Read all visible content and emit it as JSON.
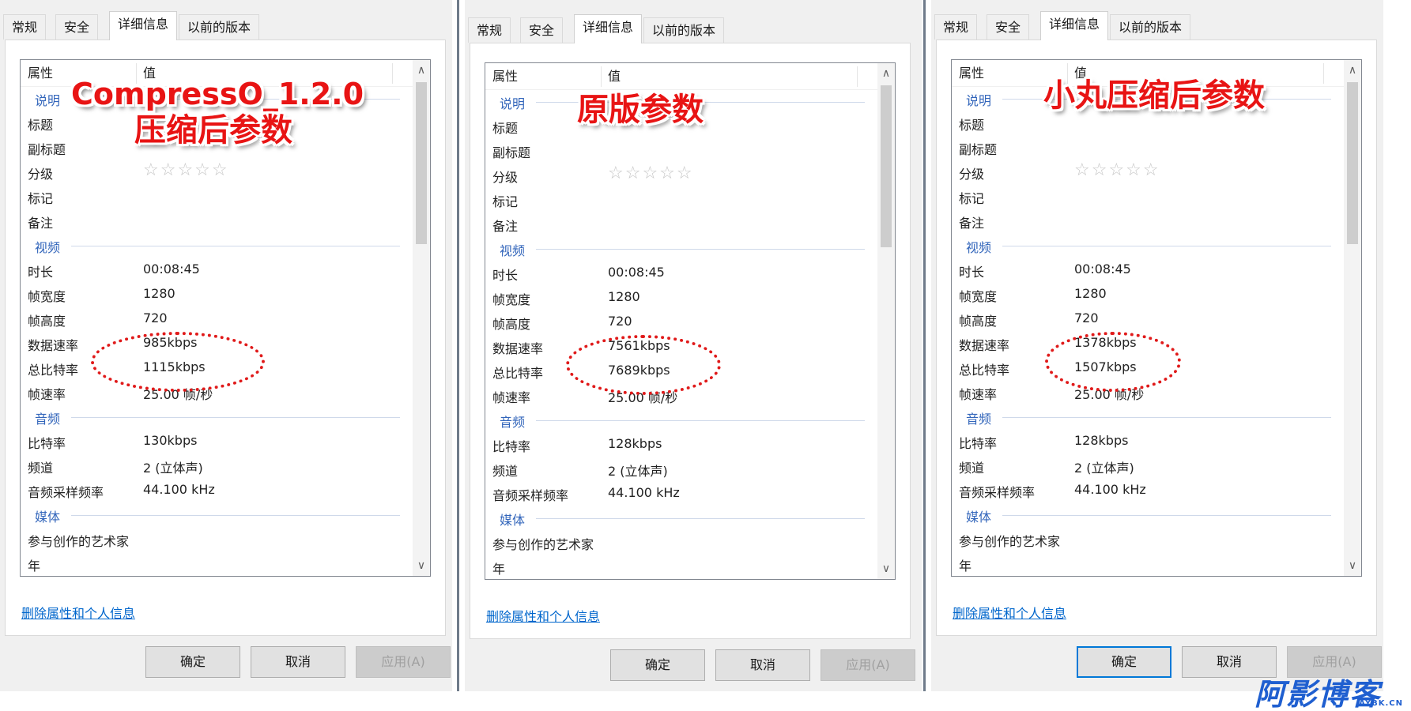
{
  "dialogs": [
    {
      "tabs": [
        "常规",
        "安全",
        "详细信息",
        "以前的版本"
      ],
      "active_tab": "详细信息",
      "columns": {
        "property": "属性",
        "value": "值"
      },
      "annotation_line1": "CompressO_1.2.0",
      "annotation_line2": "压缩后参数",
      "sections": {
        "description": {
          "title": "说明",
          "title_label": "标题",
          "subtitle_label": "副标题",
          "rating_label": "分级",
          "rating_stars": "☆☆☆☆☆",
          "tags_label": "标记",
          "comments_label": "备注"
        },
        "video": {
          "title": "视频",
          "length_label": "时长",
          "length": "00:08:45",
          "width_label": "帧宽度",
          "width": "1280",
          "height_label": "帧高度",
          "height": "720",
          "data_rate_label": "数据速率",
          "data_rate": "985kbps",
          "total_bitrate_label": "总比特率",
          "total_bitrate": "1115kbps",
          "frame_rate_label": "帧速率",
          "frame_rate": "25.00 帧/秒"
        },
        "audio": {
          "title": "音频",
          "bitrate_label": "比特率",
          "bitrate": "130kbps",
          "channels_label": "频道",
          "channels": "2 (立体声)",
          "sample_rate_label": "音频采样频率",
          "sample_rate": "44.100 kHz"
        },
        "media": {
          "title": "媒体",
          "contributing_artists_label": "参与创作的艺术家",
          "year_label": "年"
        }
      },
      "remove_link": "删除属性和个人信息",
      "buttons": {
        "ok": "确定",
        "cancel": "取消",
        "apply": "应用(A)"
      }
    },
    {
      "tabs": [
        "常规",
        "安全",
        "详细信息",
        "以前的版本"
      ],
      "active_tab": "详细信息",
      "columns": {
        "property": "属性",
        "value": "值"
      },
      "annotation_line1": "原版参数",
      "sections": {
        "description": {
          "title": "说明",
          "title_label": "标题",
          "subtitle_label": "副标题",
          "rating_label": "分级",
          "rating_stars": "☆☆☆☆☆",
          "tags_label": "标记",
          "comments_label": "备注"
        },
        "video": {
          "title": "视频",
          "length_label": "时长",
          "length": "00:08:45",
          "width_label": "帧宽度",
          "width": "1280",
          "height_label": "帧高度",
          "height": "720",
          "data_rate_label": "数据速率",
          "data_rate": "7561kbps",
          "total_bitrate_label": "总比特率",
          "total_bitrate": "7689kbps",
          "frame_rate_label": "帧速率",
          "frame_rate": "25.00 帧/秒"
        },
        "audio": {
          "title": "音频",
          "bitrate_label": "比特率",
          "bitrate": "128kbps",
          "channels_label": "频道",
          "channels": "2 (立体声)",
          "sample_rate_label": "音频采样频率",
          "sample_rate": "44.100 kHz"
        },
        "media": {
          "title": "媒体",
          "contributing_artists_label": "参与创作的艺术家",
          "year_label": "年"
        }
      },
      "remove_link": "删除属性和个人信息",
      "buttons": {
        "ok": "确定",
        "cancel": "取消",
        "apply": "应用(A)"
      }
    },
    {
      "tabs": [
        "常规",
        "安全",
        "详细信息",
        "以前的版本"
      ],
      "active_tab": "详细信息",
      "columns": {
        "property": "属性",
        "value": "值"
      },
      "annotation_line1": "小丸压缩后参数",
      "sections": {
        "description": {
          "title": "说明",
          "title_label": "标题",
          "subtitle_label": "副标题",
          "rating_label": "分级",
          "rating_stars": "☆☆☆☆☆",
          "tags_label": "标记",
          "comments_label": "备注"
        },
        "video": {
          "title": "视频",
          "length_label": "时长",
          "length": "00:08:45",
          "width_label": "帧宽度",
          "width": "1280",
          "height_label": "帧高度",
          "height": "720",
          "data_rate_label": "数据速率",
          "data_rate": "1378kbps",
          "total_bitrate_label": "总比特率",
          "total_bitrate": "1507kbps",
          "frame_rate_label": "帧速率",
          "frame_rate": "25.00 帧/秒"
        },
        "audio": {
          "title": "音频",
          "bitrate_label": "比特率",
          "bitrate": "128kbps",
          "channels_label": "频道",
          "channels": "2 (立体声)",
          "sample_rate_label": "音频采样频率",
          "sample_rate": "44.100 kHz"
        },
        "media": {
          "title": "媒体",
          "contributing_artists_label": "参与创作的艺术家",
          "year_label": "年"
        }
      },
      "remove_link": "删除属性和个人信息",
      "buttons": {
        "ok": "确定",
        "cancel": "取消",
        "apply": "应用(A)"
      }
    }
  ],
  "watermark": {
    "brand": "阿影博客",
    "domain": "AYBK.CN"
  },
  "colors": {
    "annotation": "#e81414",
    "group_header": "#3366bb",
    "link": "#0066cc",
    "brand": "#1f5fd0"
  }
}
